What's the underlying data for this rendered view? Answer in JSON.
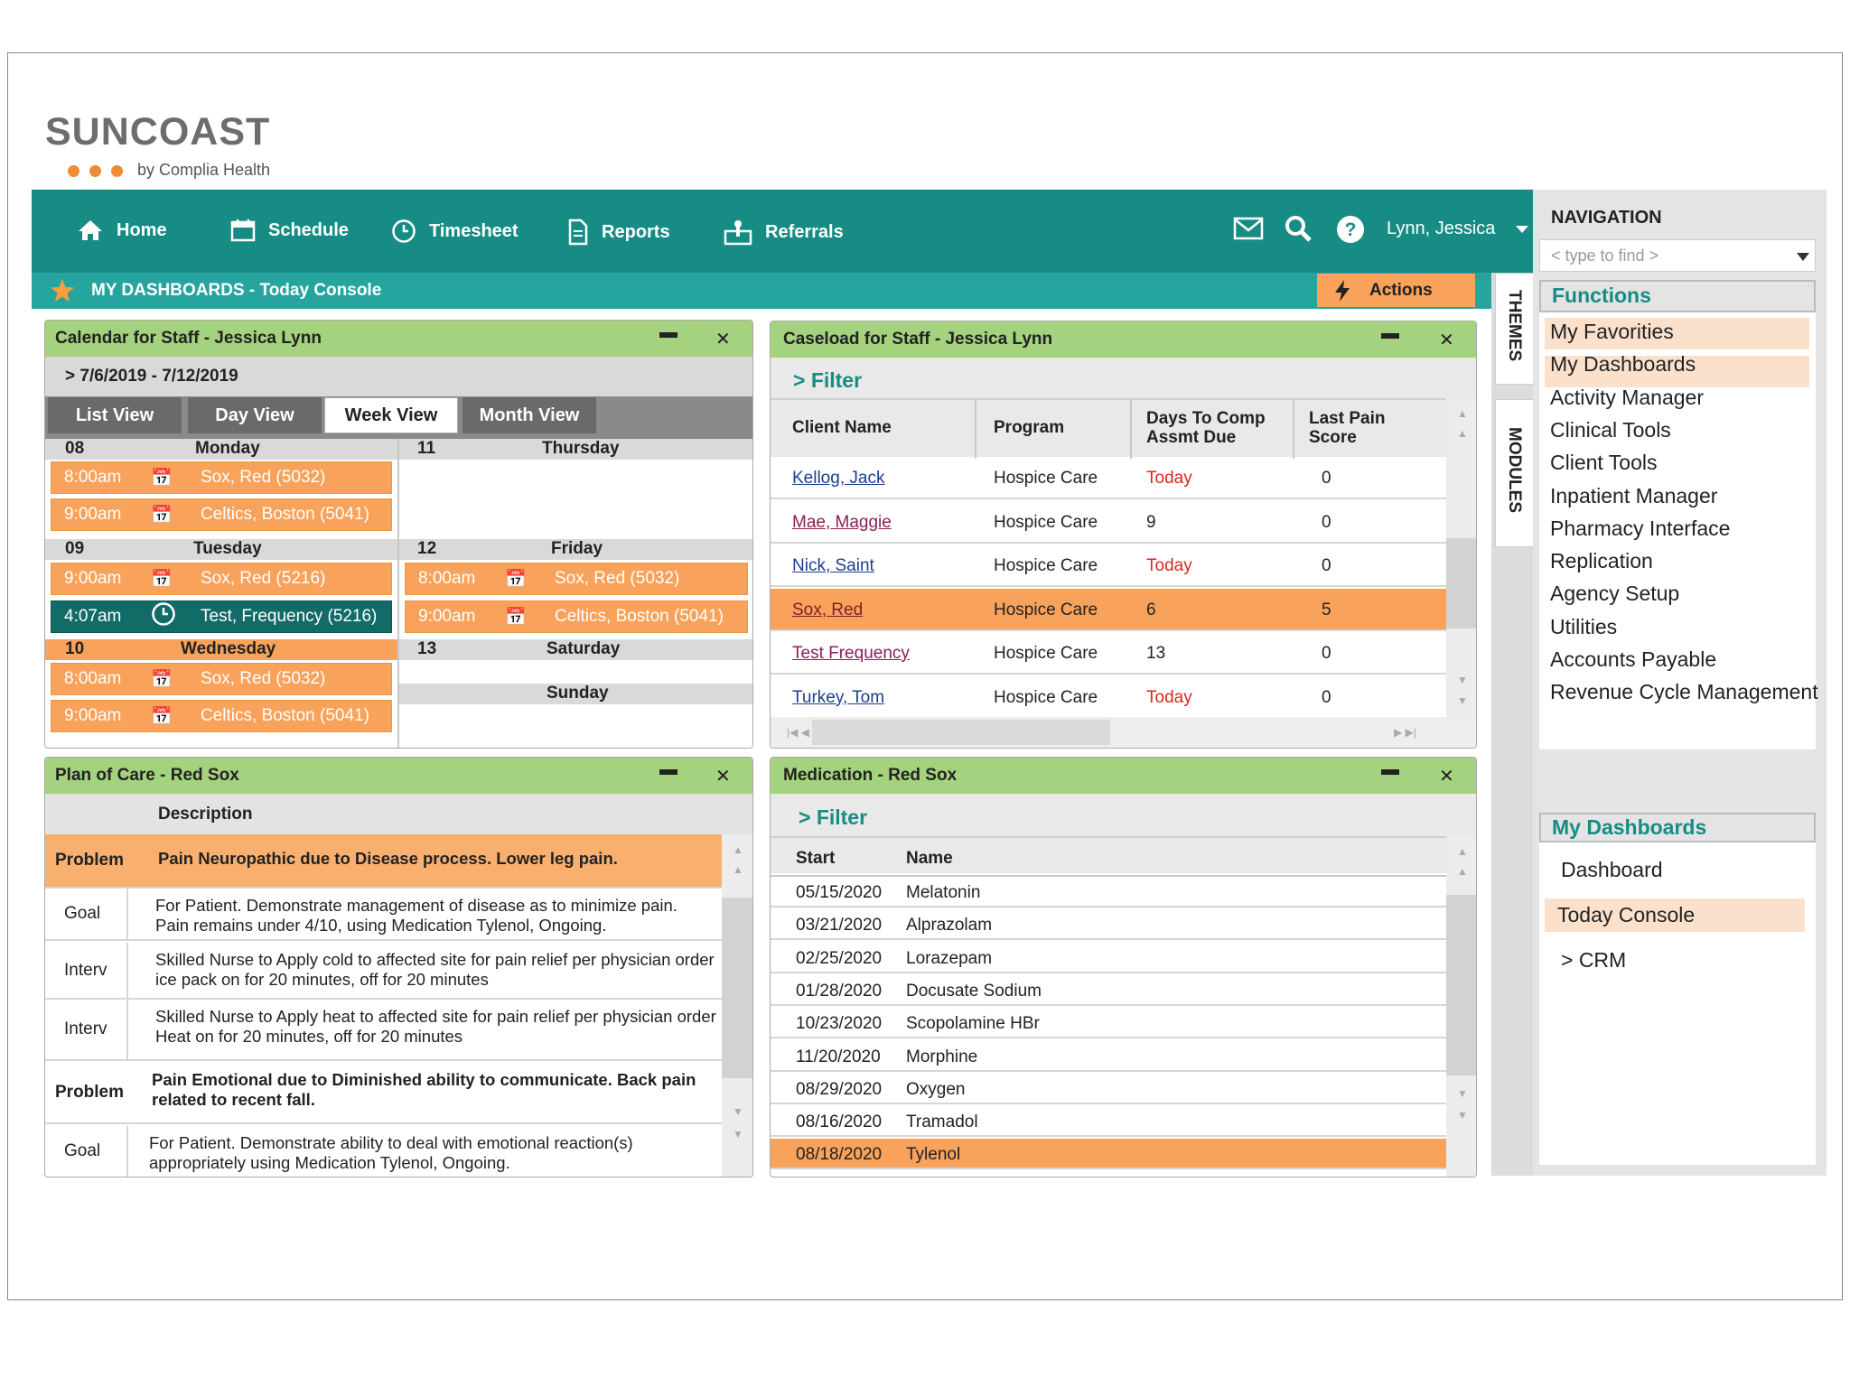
{
  "logo": {
    "word": "SUNCOAST",
    "by": "by Complia Health"
  },
  "nav": {
    "home": "Home",
    "schedule": "Schedule",
    "timesheet": "Timesheet",
    "reports": "Reports",
    "referrals": "Referrals",
    "user": "Lynn, Jessica"
  },
  "dashbar": {
    "title": "MY DASHBOARDS - Today Console",
    "actions": "Actions"
  },
  "side_tabs": {
    "themes": "THEMES",
    "modules": "MODULES"
  },
  "calendar": {
    "title": "Calendar for Staff - Jessica Lynn",
    "range": "> 7/6/2019 - 7/12/2019",
    "views": [
      "List View",
      "Day View",
      "Week View",
      "Month View"
    ],
    "active_view": "Week View",
    "days": {
      "mon": {
        "num": "08",
        "name": "Monday"
      },
      "tue": {
        "num": "09",
        "name": "Tuesday"
      },
      "wed": {
        "num": "10",
        "name": "Wednesday"
      },
      "thu": {
        "num": "11",
        "name": "Thursday"
      },
      "fri": {
        "num": "12",
        "name": "Friday"
      },
      "sat": {
        "num": "13",
        "name": "Saturday"
      },
      "sun": {
        "name": "Sunday"
      }
    },
    "entries": {
      "mon1": {
        "time": "8:00am",
        "text": "Sox, Red (5032)"
      },
      "mon2": {
        "time": "9:00am",
        "text": "Celtics, Boston (5041)"
      },
      "tue1": {
        "time": "9:00am",
        "text": "Sox, Red (5216)"
      },
      "tue2": {
        "time": "4:07am",
        "text": "Test, Frequency (5216)"
      },
      "wed1": {
        "time": "8:00am",
        "text": "Sox, Red (5032)"
      },
      "wed2": {
        "time": "9:00am",
        "text": "Celtics, Boston (5041)"
      },
      "fri1": {
        "time": "8:00am",
        "text": "Sox, Red (5032)"
      },
      "fri2": {
        "time": "9:00am",
        "text": "Celtics, Boston (5041)"
      }
    }
  },
  "caseload": {
    "title": "Caseload for Staff - Jessica Lynn",
    "filter": "> Filter",
    "headers": {
      "client": "Client Name",
      "program": "Program",
      "days1": "Days To Comp",
      "days2": "Assmt Due",
      "pain1": "Last Pain",
      "pain2": "Score"
    },
    "rows": [
      {
        "client": "Kellog, Jack",
        "program": "Hospice Care",
        "days": "Today",
        "pain": "0"
      },
      {
        "client": "Mae, Maggie",
        "program": "Hospice Care",
        "days": "9",
        "pain": "0"
      },
      {
        "client": "Nick, Saint",
        "program": "Hospice Care",
        "days": "Today",
        "pain": "0"
      },
      {
        "client": "Sox, Red",
        "program": "Hospice Care",
        "days": "6",
        "pain": "5"
      },
      {
        "client": "Test Frequency",
        "program": "Hospice Care",
        "days": "13",
        "pain": "0"
      },
      {
        "client": "Turkey, Tom",
        "program": "Hospice Care",
        "days": "Today",
        "pain": "0"
      }
    ]
  },
  "plan": {
    "title": "Plan of Care - Red Sox",
    "header": "Description",
    "rows": [
      {
        "type": "Problem",
        "l1": "Pain Neuropathic due to Disease process. Lower leg pain.",
        "l2": ""
      },
      {
        "type": "Goal",
        "l1": "For Patient. Demonstrate management of disease as to minimize pain.",
        "l2": "Pain remains under 4/10, using Medication Tylenol, Ongoing."
      },
      {
        "type": "Interv",
        "l1": "Skilled Nurse to Apply cold to affected site for pain relief per physician order",
        "l2": "ice pack on for 20 minutes, off for 20 minutes"
      },
      {
        "type": "Interv",
        "l1": "Skilled Nurse to Apply heat to affected site for pain relief per physician order",
        "l2": "Heat on for 20 minutes, off for 20 minutes"
      },
      {
        "type": "Problem",
        "l1": "Pain Emotional due to Diminished ability to communicate. Back pain",
        "l2": "related to recent fall."
      },
      {
        "type": "Goal",
        "l1": "For Patient. Demonstrate ability to deal with emotional reaction(s)",
        "l2": "appropriately using Medication Tylenol, Ongoing."
      }
    ]
  },
  "medication": {
    "title": "Medication - Red Sox",
    "filter": "> Filter",
    "headers": {
      "start": "Start",
      "name": "Name"
    },
    "rows": [
      {
        "start": "05/15/2020",
        "name": "Melatonin"
      },
      {
        "start": "03/21/2020",
        "name": "Alprazolam"
      },
      {
        "start": "02/25/2020",
        "name": "Lorazepam"
      },
      {
        "start": "01/28/2020",
        "name": "Docusate Sodium"
      },
      {
        "start": "10/23/2020",
        "name": "Scopolamine HBr"
      },
      {
        "start": "11/20/2020",
        "name": "Morphine"
      },
      {
        "start": "08/29/2020",
        "name": "Oxygen"
      },
      {
        "start": "08/16/2020",
        "name": "Tramadol"
      },
      {
        "start": "08/18/2020",
        "name": "Tylenol"
      }
    ]
  },
  "rightnav": {
    "heading": "NAVIGATION",
    "search_placeholder": "< type to find >",
    "functions": "Functions",
    "items": [
      "My Favorities",
      "My Dashboards",
      "Activity Manager",
      "Clinical Tools",
      "Client Tools",
      "Inpatient Manager",
      "Pharmacy Interface",
      "Replication",
      "Agency Setup",
      "Utilities",
      "Accounts Payable",
      "Revenue Cycle Management"
    ],
    "dash_heading": "My Dashboards",
    "dash_items": [
      "Dashboard",
      "Today Console",
      "> CRM"
    ]
  },
  "colors": {
    "teal": "#178c85",
    "orange": "#f9a25b",
    "green": "#a4d27f",
    "red_text": "#d9281c"
  }
}
